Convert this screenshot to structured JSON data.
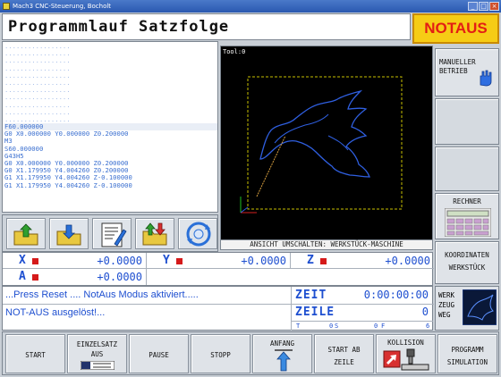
{
  "window": {
    "title": "Mach3 CNC-Steuerung, Bocholt"
  },
  "header": {
    "title": "Programmlauf Satzfolge",
    "emergency_label": "NOTAUS"
  },
  "gcode": {
    "lines": [
      ".................",
      ".................",
      ".................",
      ".................",
      ".................",
      ".................",
      ".................",
      ".................",
      ".................",
      ".................",
      ".................",
      "F60.000000",
      "G0 X0.000000 Y0.000000 Z0.200000",
      "M3",
      "S60.000000",
      "G43H5",
      "G0 X0.000000 Y0.000000 Z0.200000",
      "G0 X1.179950 Y4.004260 Z0.200000",
      "G1 X1.179950 Y4.004260 Z-0.100000",
      "G1 X1.179950 Y4.004260 Z-0.100000"
    ],
    "current_index": 11
  },
  "toolpath": {
    "tool_label": "Tool:0",
    "caption": "ANSICHT UMSCHALTEN: WERKSTÜCK-MASCHINE"
  },
  "side": {
    "manual_line1": "MANUELLER",
    "manual_line2": "BETRIEB",
    "calc_label": "RECHNER",
    "coord_line1": "KOORDINATEN",
    "coord_line2": "WERKSTÜCK",
    "tool_line1": "WERK",
    "tool_line2": "ZEUG",
    "tool_line3": "WEG"
  },
  "coords": {
    "x_label": "X",
    "x_value": "+0.0000",
    "y_label": "Y",
    "y_value": "+0.0000",
    "z_label": "Z",
    "z_value": "+0.0000",
    "a_label": "A",
    "a_value": "+0.0000"
  },
  "status": {
    "message1": "...Press Reset .... NotAus Modus aktiviert.....",
    "message2": "NOT-AUS ausgelöst!...",
    "time_label": "ZEIT",
    "time_value": "0:00:00:00",
    "line_label": "ZEILE",
    "line_value": "0",
    "t_label": "T",
    "t_value": "0",
    "s_label": "S",
    "s_value": "0",
    "f_label": "F",
    "f_value": "6"
  },
  "bottom": {
    "start": "START",
    "single_line1": "EINZELSATZ",
    "single_line2": "AUS",
    "pause": "PAUSE",
    "stop": "STOPP",
    "start_pos": "ANFANG",
    "start_from_line1": "START AB",
    "start_from_line2": "ZEILE",
    "collision": "KOLLISION",
    "sim_line1": "PROGRAMM",
    "sim_line2": "SIMULATION"
  }
}
